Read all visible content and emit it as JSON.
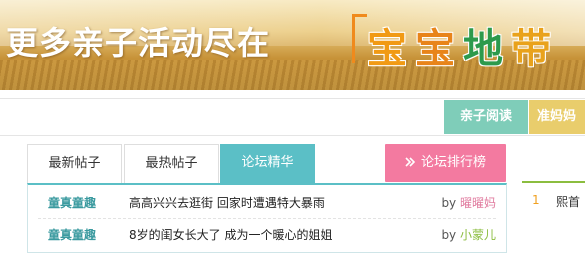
{
  "banner": {
    "slogan": "更多亲子活动尽在",
    "brand_chars": [
      "宝",
      "宝",
      "地",
      "带"
    ]
  },
  "nav": {
    "read": "亲子阅读",
    "mom": "准妈妈"
  },
  "tabs": [
    {
      "label": "最新帖子"
    },
    {
      "label": "最热帖子"
    },
    {
      "label": "论坛精华",
      "active": true
    }
  ],
  "rank_button": "论坛排行榜",
  "posts": [
    {
      "category": "童真童趣",
      "title": "高高兴兴去逛街 回家时遭遇特大暴雨",
      "by": "by",
      "author": "曜曜妈"
    },
    {
      "category": "童真童趣",
      "title": "8岁的闺女长大了 成为一个暖心的姐姐",
      "by": "by",
      "author": "小蒙儿"
    }
  ],
  "side": {
    "rank": "1",
    "name": "熙首"
  },
  "colors": {
    "teal": "#5bbfc6",
    "pink": "#f37aa0",
    "mint": "#7fcdb9",
    "yellow": "#e9cd6c",
    "green": "#8bbd3f"
  }
}
